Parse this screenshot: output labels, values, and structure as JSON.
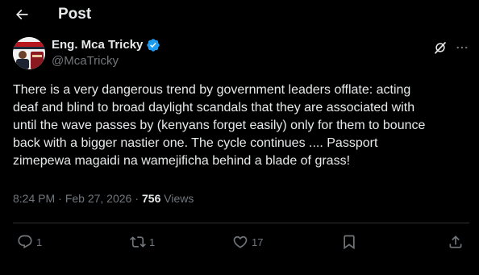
{
  "header": {
    "title": "Post",
    "back_icon": "arrow-left-icon"
  },
  "author": {
    "name": "Eng. Mca Tricky",
    "handle": "@McaTricky",
    "verified": true,
    "verified_color": "#1d9bf0"
  },
  "post": {
    "text": "There is a very dangerous trend by government leaders offlate: acting\ndeaf and blind to broad daylight scandals that they are associated with\nuntil the wave passes by  (kenyans forget easily) only for them to bounce\nback with a bigger nastier one. The cycle continues .... Passport\nzimepewa magaidi na wamejificha behind a blade of grass!",
    "time": "8:24 PM",
    "separator": "·",
    "date": "Feb 27, 2026",
    "views_count": "756",
    "views_label": "Views"
  },
  "actions": {
    "replies": "1",
    "reposts": "1",
    "likes": "17"
  },
  "colors": {
    "background": "#000000",
    "text": "#e7e9ea",
    "muted": "#71767b",
    "divider": "#2f3336"
  }
}
